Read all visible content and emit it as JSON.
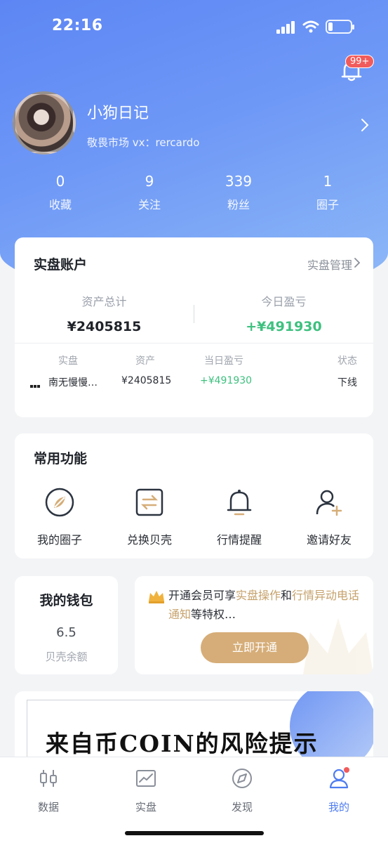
{
  "status_bar": {
    "time": "22:16"
  },
  "notifications": {
    "badge": "99+"
  },
  "profile": {
    "name": "小狗日记",
    "subtitle": "敬畏市场 vx：rercardo",
    "stats": [
      {
        "value": "0",
        "label": "收藏"
      },
      {
        "value": "9",
        "label": "关注"
      },
      {
        "value": "339",
        "label": "粉丝"
      },
      {
        "value": "1",
        "label": "圈子"
      }
    ]
  },
  "account": {
    "title": "实盘账户",
    "manage": "实盘管理",
    "total_label": "资产总计",
    "total_value": "¥2405815",
    "pnl_label": "今日盈亏",
    "pnl_value": "+¥491930",
    "columns": [
      "实盘",
      "资产",
      "当日盈亏",
      "状态"
    ],
    "row": {
      "name": "南无慢慢…",
      "assets": "¥2405815",
      "pnl": "+¥491930",
      "status": "下线"
    }
  },
  "functions": {
    "title": "常用功能",
    "items": [
      {
        "label": "我的圈子",
        "icon": "compass-icon"
      },
      {
        "label": "兑换贝壳",
        "icon": "exchange-icon"
      },
      {
        "label": "行情提醒",
        "icon": "bell-icon"
      },
      {
        "label": "邀请好友",
        "icon": "add-user-icon"
      }
    ]
  },
  "wallet": {
    "title": "我的钱包",
    "value": "6.5",
    "label": "贝壳余额"
  },
  "promo": {
    "t1": "开通会员可享",
    "h1": "实盘操作",
    "t2": "和",
    "h2": "行情异动电话通知",
    "t3": "等特权…",
    "button": "立即开通"
  },
  "risk_banner": {
    "text": "来自币COIN的风险提示"
  },
  "tabbar": [
    {
      "label": "数据",
      "icon": "candlestick-icon"
    },
    {
      "label": "实盘",
      "icon": "chart-icon"
    },
    {
      "label": "发现",
      "icon": "compass-icon"
    },
    {
      "label": "我的",
      "icon": "user-icon"
    }
  ],
  "colors": {
    "accent": "#4e7cf0",
    "gold": "#d6ad78",
    "profit": "#3ec07f",
    "badge": "#f25b5b"
  }
}
